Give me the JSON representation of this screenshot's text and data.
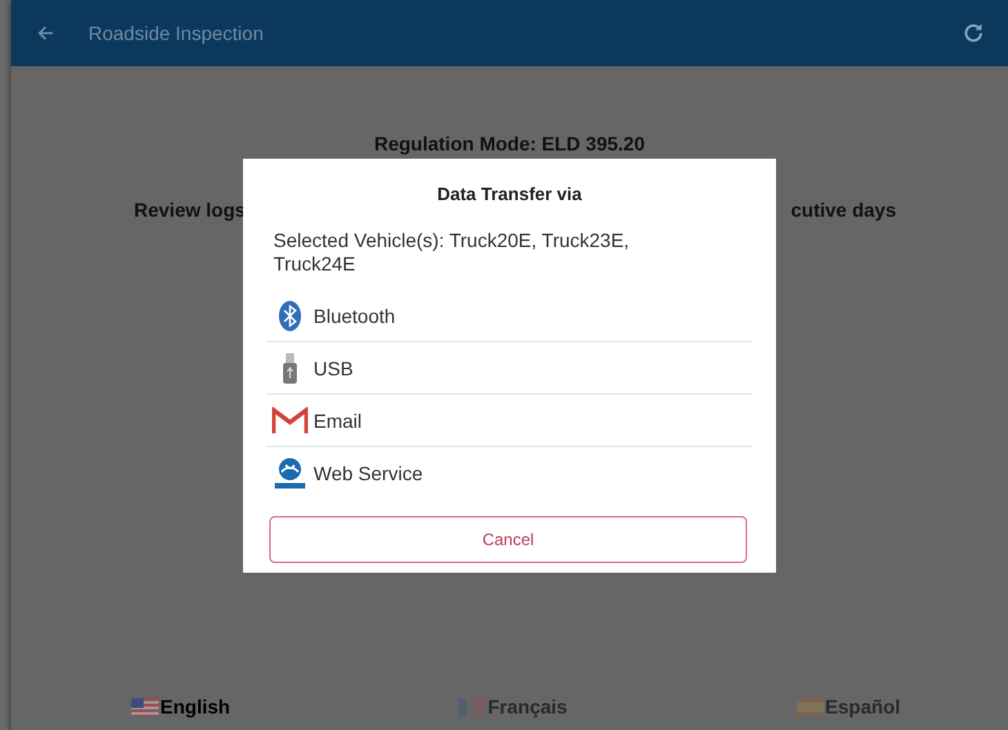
{
  "app_bar": {
    "title": "Roadside Inspection"
  },
  "content": {
    "regulation_mode": "Regulation Mode: ELD 395.20",
    "review_left": "Review logs",
    "review_right": "cutive days"
  },
  "languages": [
    {
      "label": "English",
      "kind": "us",
      "selected": true
    },
    {
      "label": "Français",
      "kind": "fr",
      "selected": false
    },
    {
      "label": "Español",
      "kind": "es",
      "selected": false
    }
  ],
  "dialog": {
    "title": "Data Transfer via",
    "selected_vehicles": "Selected Vehicle(s): Truck20E, Truck23E, Truck24E",
    "options": [
      {
        "label": "Bluetooth",
        "kind": "bluetooth"
      },
      {
        "label": "USB",
        "kind": "usb"
      },
      {
        "label": "Email",
        "kind": "email"
      },
      {
        "label": "Web Service",
        "kind": "web"
      }
    ],
    "cancel": "Cancel"
  }
}
